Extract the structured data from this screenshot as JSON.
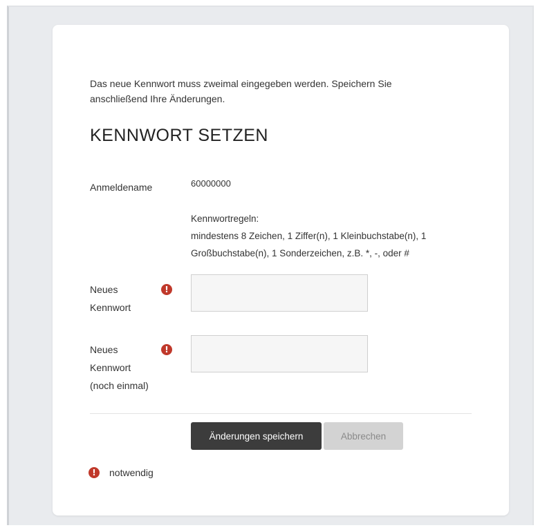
{
  "intro": {
    "line1": "Das neue Kennwort muss zweimal eingegeben werden. Speichern Sie",
    "line2": "anschließend Ihre Änderungen."
  },
  "title": "KENNWORT SETZEN",
  "login": {
    "label": "Anmeldename",
    "value": "60000000"
  },
  "rules": {
    "heading": "Kennwortregeln:",
    "line1": "mindestens 8 Zeichen, 1 Ziffer(n), 1 Kleinbuchstabe(n), 1",
    "line2": "Großbuchstabe(n), 1 Sonderzeichen, z.B. *, -, oder #"
  },
  "new_password": {
    "label_line1": "Neues",
    "label_line2": "Kennwort",
    "value": ""
  },
  "confirm_password": {
    "label_line1": "Neues",
    "label_line2": "Kennwort",
    "label_line3": "(noch einmal)",
    "value": ""
  },
  "required_icon": "exclamation-circle-icon",
  "buttons": {
    "save": "Änderungen speichern",
    "cancel": "Abbrechen"
  },
  "legend": {
    "required_text": "notwendig"
  },
  "colors": {
    "required": "#c0392b",
    "primary_button": "#3c3c3c",
    "secondary_button": "#d3d3d3",
    "background": "#e9ebee"
  }
}
